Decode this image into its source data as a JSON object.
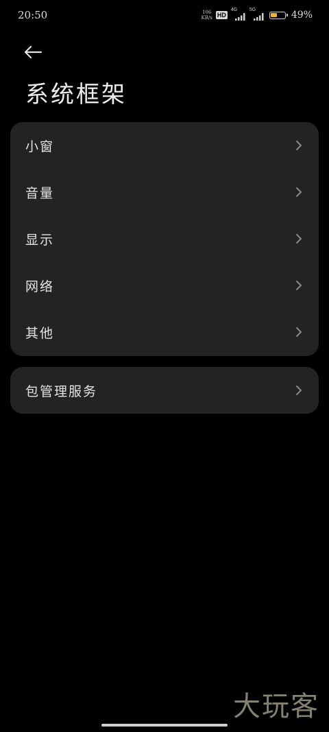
{
  "status_bar": {
    "time": "20:50",
    "net_speed_value": "106",
    "net_speed_unit": "KB/s",
    "hd_label": "HD",
    "signal_1_label": "4G",
    "signal_2_label": "5G",
    "battery_percent": "49%",
    "battery_level": 0.49,
    "battery_color": "#f0b428"
  },
  "header": {
    "back_icon": "arrow-left-icon",
    "title": "系统框架"
  },
  "menu": {
    "items": [
      {
        "label": "小窗"
      },
      {
        "label": "音量"
      },
      {
        "label": "显示"
      },
      {
        "label": "网络"
      },
      {
        "label": "其他"
      }
    ],
    "secondary_items": [
      {
        "label": "包管理服务"
      }
    ],
    "chevron_icon": "chevron-right-icon"
  },
  "watermark": {
    "text": "大玩客"
  },
  "colors": {
    "background": "#000000",
    "card": "#232323",
    "text": "#e4e4e4"
  }
}
